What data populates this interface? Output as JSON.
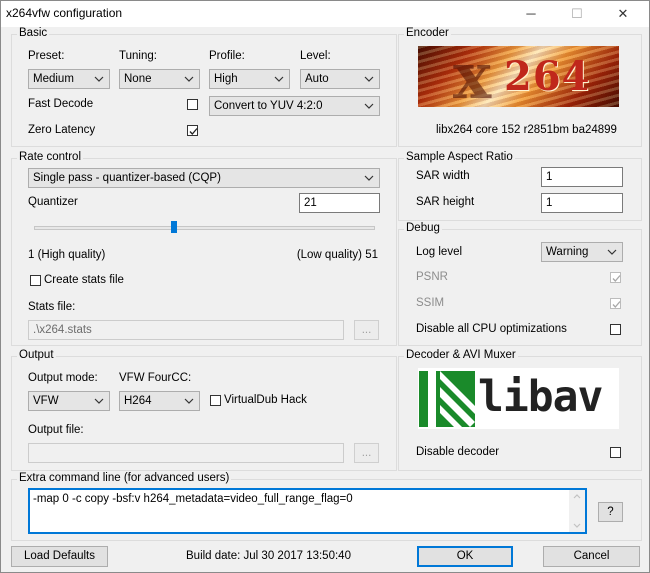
{
  "window": {
    "title": "x264vfw configuration",
    "minimize": "─",
    "maximize": "☐",
    "close": "✕"
  },
  "basic": {
    "group_label": "Basic",
    "preset_label": "Preset:",
    "preset_value": "Medium",
    "tuning_label": "Tuning:",
    "tuning_value": "None",
    "profile_label": "Profile:",
    "profile_value": "High",
    "level_label": "Level:",
    "level_value": "Auto",
    "fast_decode_label": "Fast Decode",
    "fast_decode_checked": false,
    "zero_latency_label": "Zero Latency",
    "zero_latency_checked": true,
    "colorspace_value": "Convert to YUV 4:2:0"
  },
  "encoder": {
    "group_label": "Encoder",
    "logo_text": "264",
    "version": "libx264 core 152 r2851bm ba24899"
  },
  "rate_control": {
    "group_label": "Rate control",
    "mode_value": "Single pass - quantizer-based (CQP)",
    "quantizer_label": "Quantizer",
    "quantizer_value": "21",
    "slider_fraction": 0.41,
    "low_label": "1 (High quality)",
    "high_label": "(Low quality) 51",
    "create_stats_label": "Create stats file",
    "create_stats_checked": false,
    "stats_file_label": "Stats file:",
    "stats_file_value": ".\\x264.stats",
    "browse_label": "..."
  },
  "sar": {
    "group_label": "Sample Aspect Ratio",
    "width_label": "SAR width",
    "width_value": "1",
    "height_label": "SAR height",
    "height_value": "1"
  },
  "debug": {
    "group_label": "Debug",
    "log_level_label": "Log level",
    "log_level_value": "Warning",
    "psnr_label": "PSNR",
    "psnr_checked": true,
    "ssim_label": "SSIM",
    "ssim_checked": true,
    "disable_cpu_label": "Disable all CPU optimizations",
    "disable_cpu_checked": false
  },
  "output": {
    "group_label": "Output",
    "mode_label": "Output mode:",
    "mode_value": "VFW",
    "fourcc_label": "VFW FourCC:",
    "fourcc_value": "H264",
    "vdub_label": "VirtualDub Hack",
    "vdub_checked": false,
    "file_label": "Output file:",
    "file_value": "",
    "browse_label": "..."
  },
  "decoder": {
    "group_label": "Decoder & AVI Muxer",
    "logo_text": "libav",
    "disable_label": "Disable decoder",
    "disable_checked": false
  },
  "extra": {
    "group_label": "Extra command line (for advanced users)",
    "value": "-map 0 -c copy -bsf:v h264_metadata=video_full_range_flag=0",
    "help_label": "?"
  },
  "footer": {
    "load_defaults": "Load Defaults",
    "build_date": "Build date: Jul 30 2017 13:50:40",
    "ok": "OK",
    "cancel": "Cancel"
  },
  "colors": {
    "accent": "#0078d7",
    "libav_green": "#1a8a2a",
    "encoder_red": "#c0271b"
  }
}
